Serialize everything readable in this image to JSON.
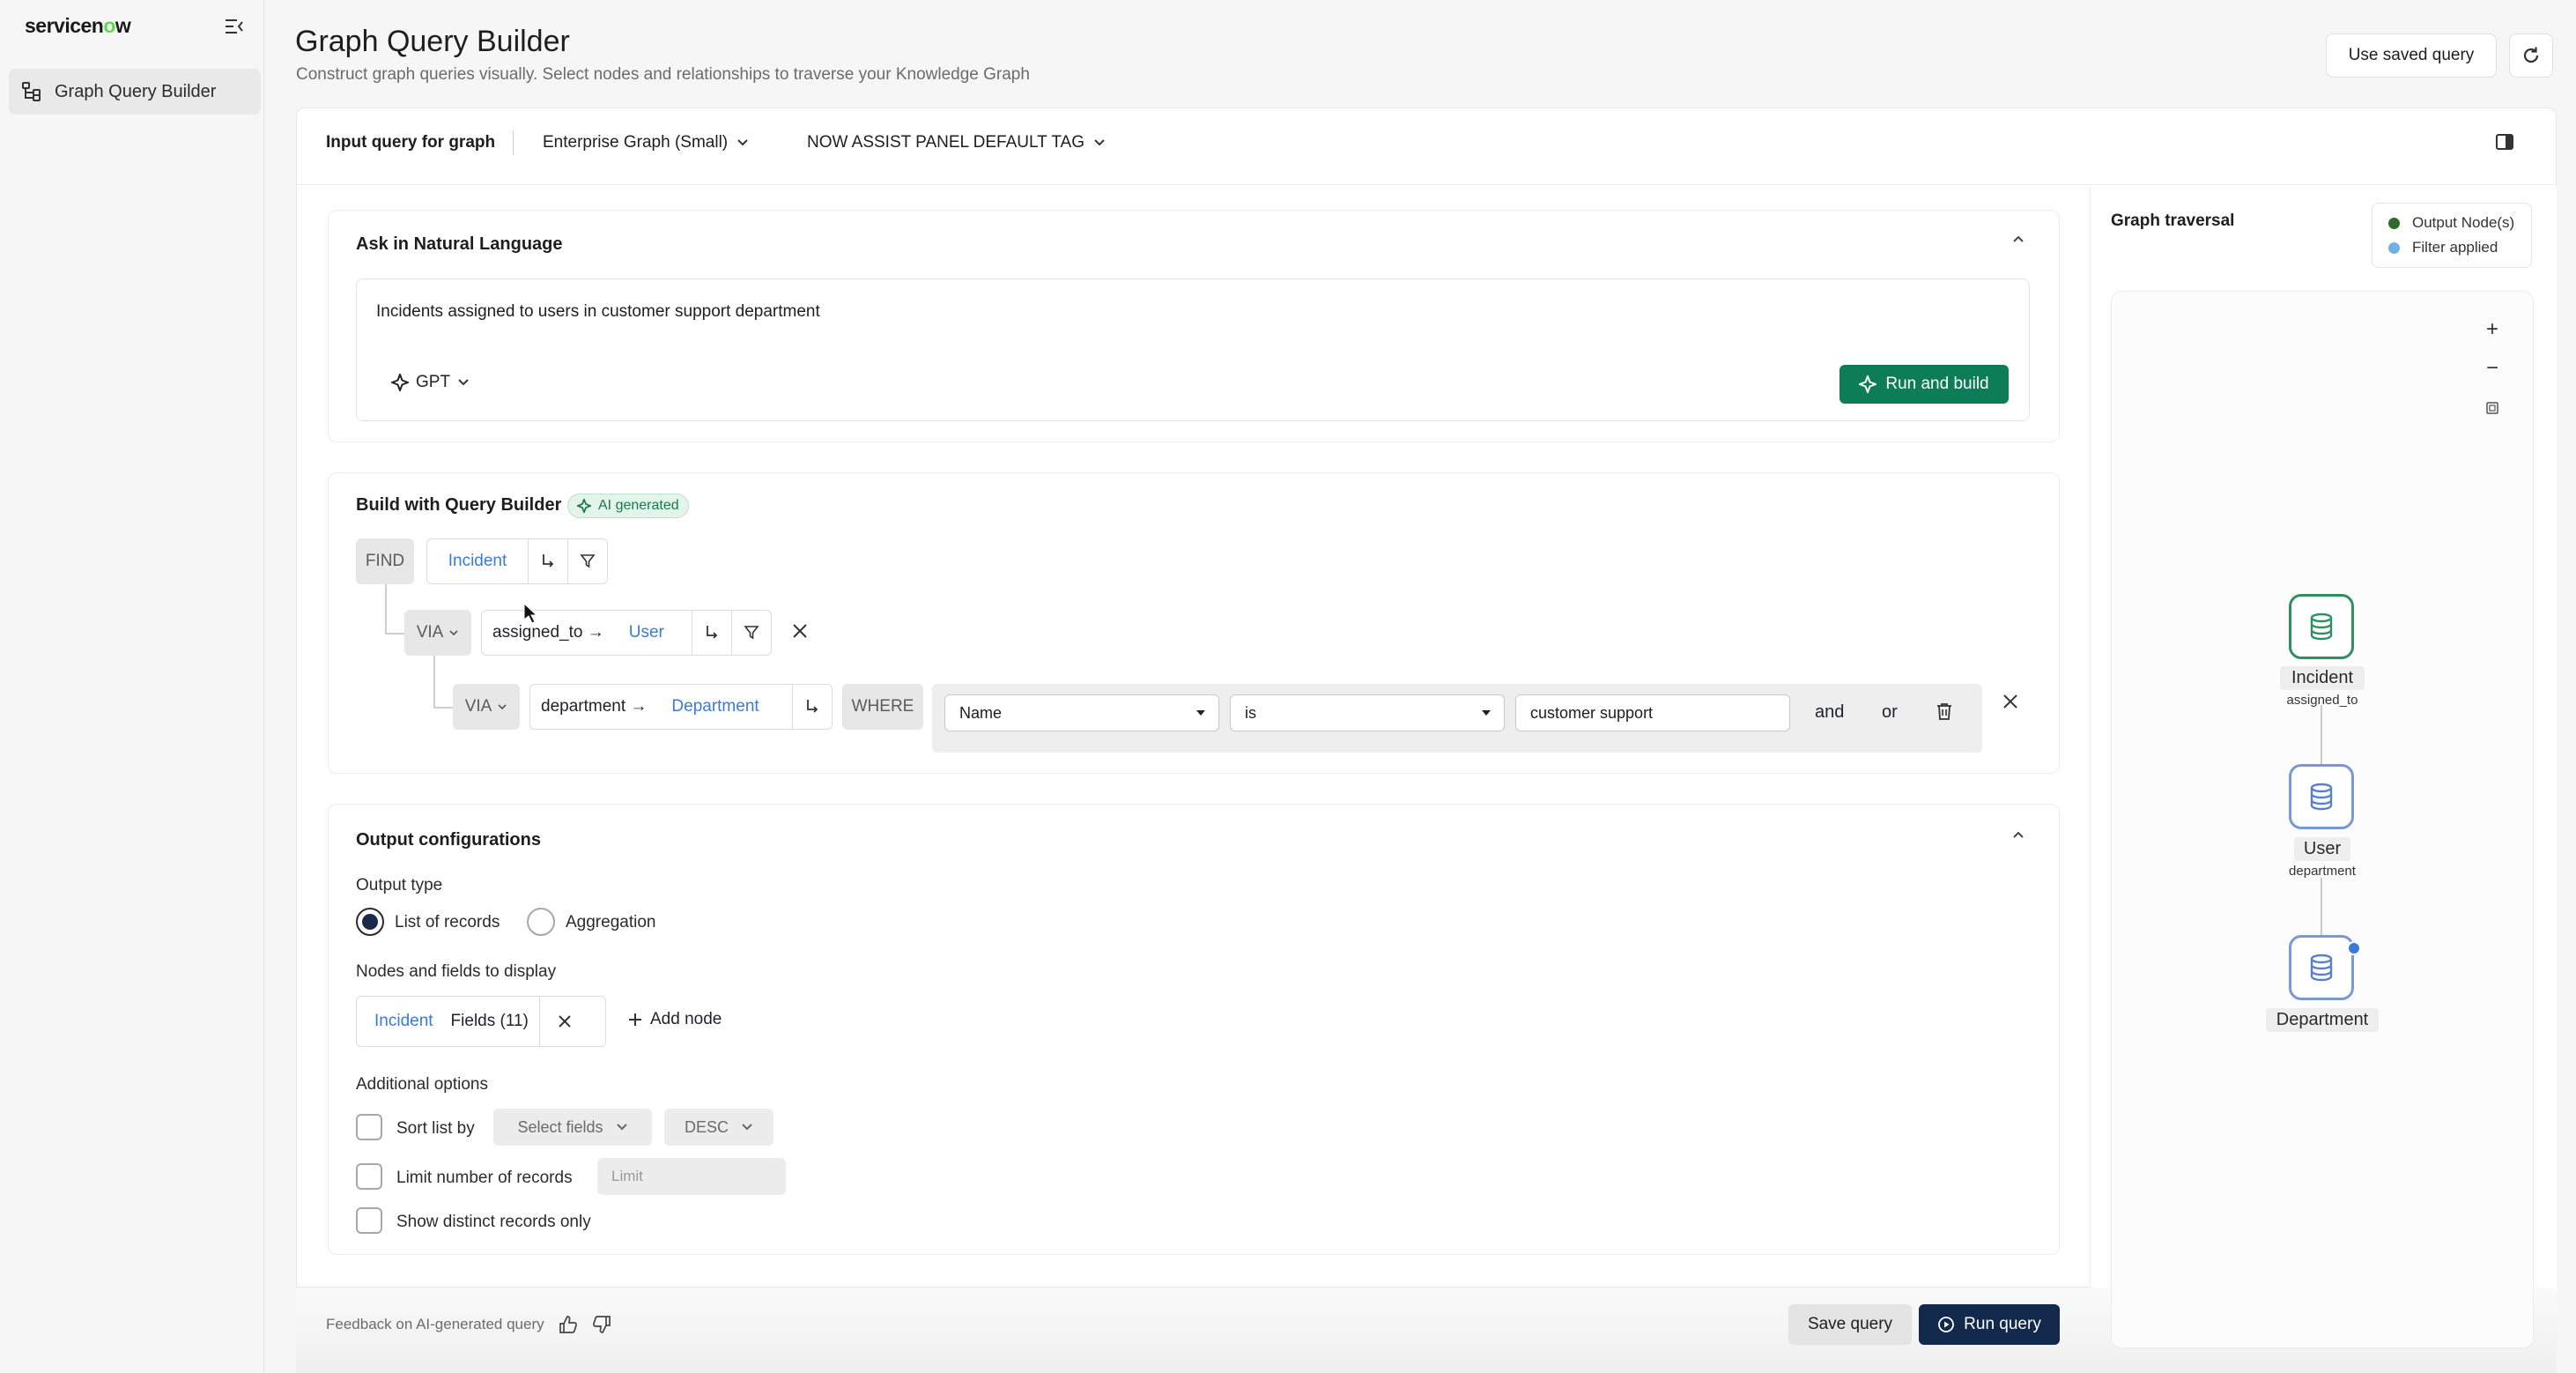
{
  "sidebar": {
    "logo": "servicenow",
    "items": [
      {
        "label": "Graph Query Builder"
      }
    ]
  },
  "header": {
    "title": "Graph Query Builder",
    "subtitle": "Construct graph queries visually. Select nodes and relationships to traverse your Knowledge Graph",
    "saved_query_label": "Use saved query"
  },
  "topbar": {
    "input_label": "Input query for graph",
    "graph_select": "Enterprise Graph (Small)",
    "tag_select": "NOW ASSIST PANEL DEFAULT TAG"
  },
  "natural_language": {
    "title": "Ask in Natural Language",
    "query_text": "Incidents assigned to users in customer support department",
    "model": "GPT",
    "run_build_label": "Run and build"
  },
  "builder": {
    "title": "Build with Query Builder",
    "badge": "AI generated",
    "find_label": "FIND",
    "find_node": "Incident",
    "via1_label": "VIA",
    "via1_rel": "assigned_to →",
    "via1_node": "User",
    "via2_label": "VIA",
    "via2_rel": "department →",
    "via2_node": "Department",
    "where_label": "WHERE",
    "condition": {
      "field": "Name",
      "operator": "is",
      "value": "customer support",
      "and_label": "and",
      "or_label": "or"
    }
  },
  "output": {
    "title": "Output configurations",
    "type_label": "Output type",
    "type_options": [
      "List of records",
      "Aggregation"
    ],
    "type_selected": "List of records",
    "nodes_label": "Nodes and fields to display",
    "node_chip": "Incident",
    "fields_chip": "Fields (11)",
    "add_node_label": "Add node",
    "additional_label": "Additional options",
    "sort_label": "Sort list by",
    "sort_fields": "Select fields",
    "sort_order": "DESC",
    "limit_label": "Limit number of records",
    "limit_placeholder": "Limit",
    "distinct_label": "Show distinct records only"
  },
  "footer": {
    "feedback_label": "Feedback on AI-generated query",
    "save_label": "Save query",
    "run_label": "Run query"
  },
  "graph": {
    "title": "Graph traversal",
    "legend": [
      {
        "label": "Output Node(s)",
        "color": "#2f6b2f"
      },
      {
        "label": "Filter applied",
        "color": "#6fb0e6"
      }
    ],
    "nodes": [
      {
        "label": "Incident",
        "sub": "assigned_to"
      },
      {
        "label": "User",
        "sub": "department"
      },
      {
        "label": "Department",
        "sub": ""
      }
    ]
  },
  "colors": {
    "accent_green": "#0d7d57",
    "navy": "#13294b",
    "link_blue": "#3b7ad9"
  }
}
